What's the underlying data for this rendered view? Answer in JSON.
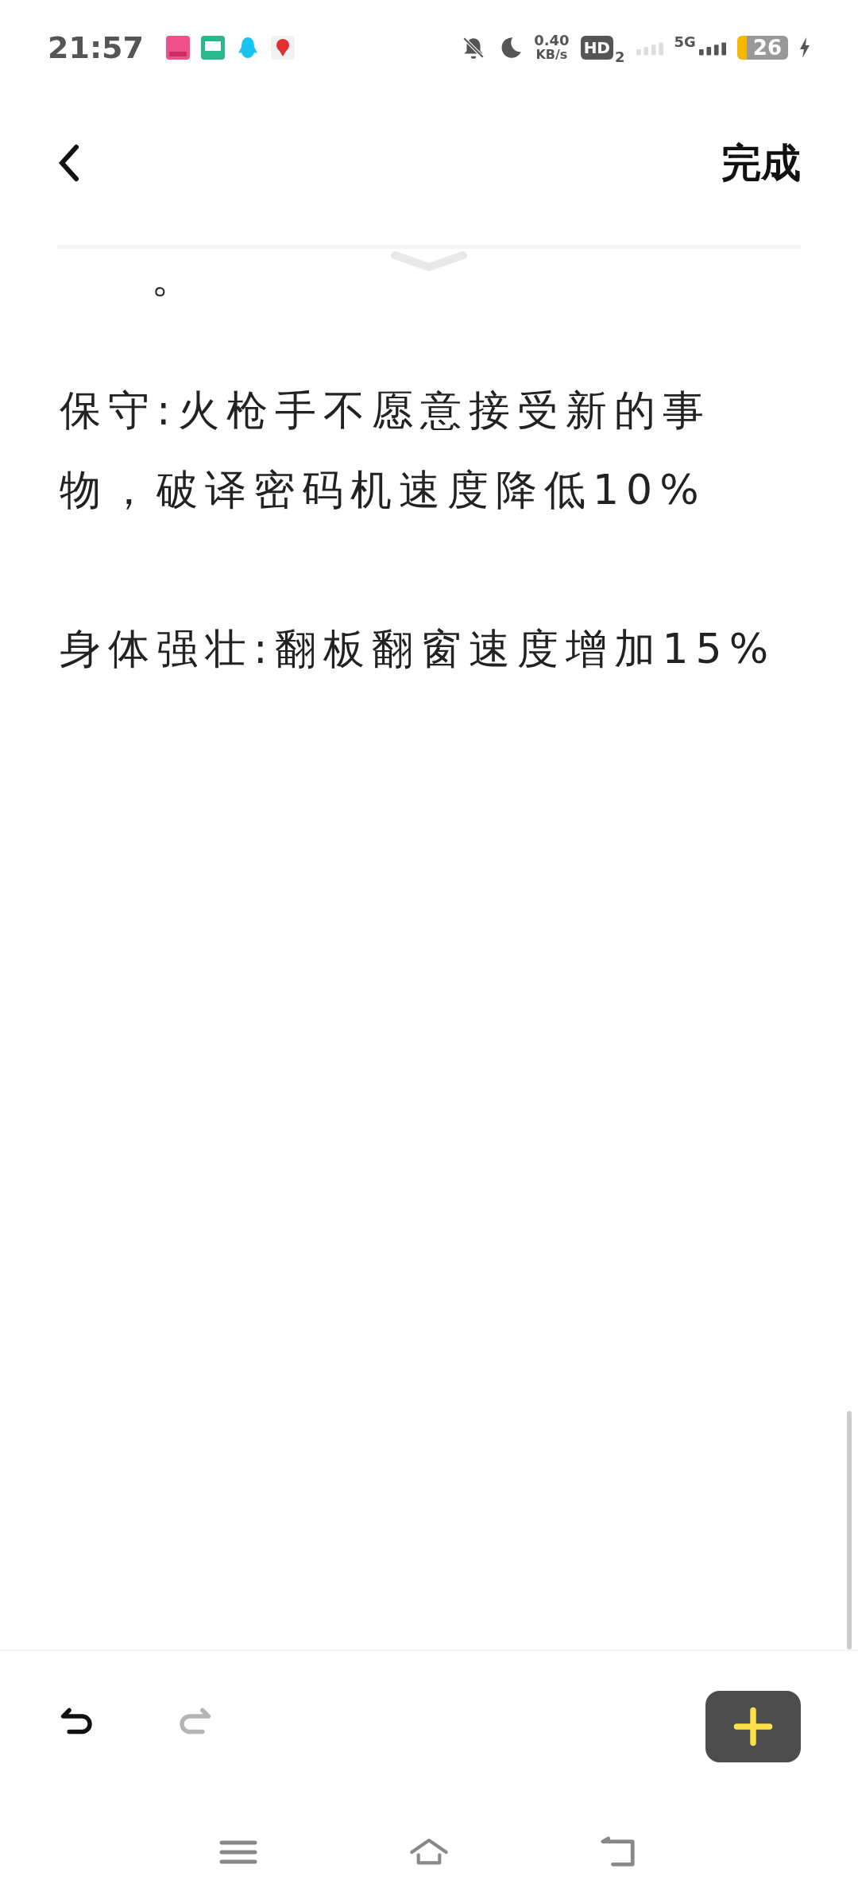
{
  "status_bar": {
    "time": "21:57",
    "net_speed": "0.40",
    "net_unit": "KB/s",
    "hd": "HD",
    "hd_sub": "2",
    "network": "5G",
    "battery": "26",
    "charging": true
  },
  "header": {
    "done": "完成"
  },
  "note": {
    "cut_line": "。",
    "paragraphs": [
      "保守:火枪手不愿意接受新的事物，破译密码机速度降低10%",
      "身体强壮:翻板翻窗速度增加15%"
    ]
  },
  "toolbar": {
    "undo": {
      "disabled": false
    },
    "redo": {
      "disabled": true
    }
  }
}
